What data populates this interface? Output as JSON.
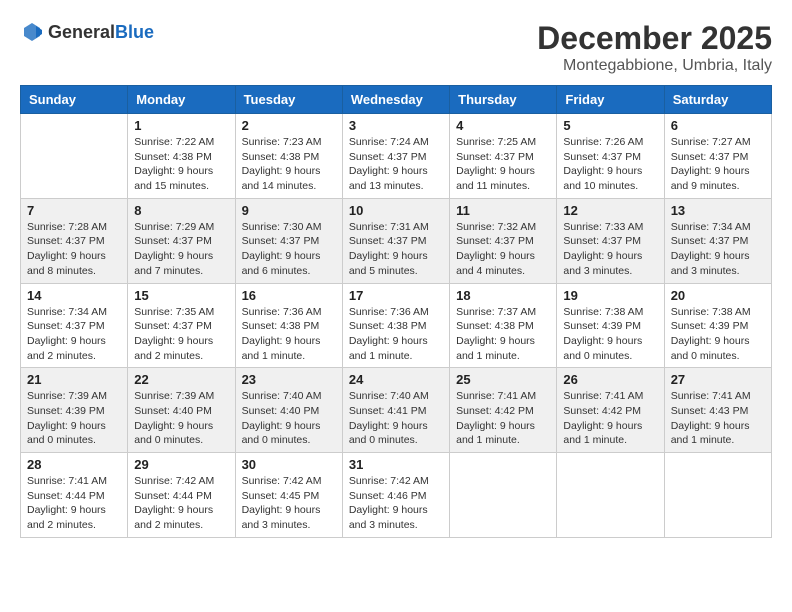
{
  "header": {
    "logo_general": "General",
    "logo_blue": "Blue",
    "month": "December 2025",
    "location": "Montegabbione, Umbria, Italy"
  },
  "weekdays": [
    "Sunday",
    "Monday",
    "Tuesday",
    "Wednesday",
    "Thursday",
    "Friday",
    "Saturday"
  ],
  "weeks": [
    [
      {
        "day": "",
        "info": ""
      },
      {
        "day": "1",
        "info": "Sunrise: 7:22 AM\nSunset: 4:38 PM\nDaylight: 9 hours\nand 15 minutes."
      },
      {
        "day": "2",
        "info": "Sunrise: 7:23 AM\nSunset: 4:38 PM\nDaylight: 9 hours\nand 14 minutes."
      },
      {
        "day": "3",
        "info": "Sunrise: 7:24 AM\nSunset: 4:37 PM\nDaylight: 9 hours\nand 13 minutes."
      },
      {
        "day": "4",
        "info": "Sunrise: 7:25 AM\nSunset: 4:37 PM\nDaylight: 9 hours\nand 11 minutes."
      },
      {
        "day": "5",
        "info": "Sunrise: 7:26 AM\nSunset: 4:37 PM\nDaylight: 9 hours\nand 10 minutes."
      },
      {
        "day": "6",
        "info": "Sunrise: 7:27 AM\nSunset: 4:37 PM\nDaylight: 9 hours\nand 9 minutes."
      }
    ],
    [
      {
        "day": "7",
        "info": "Sunrise: 7:28 AM\nSunset: 4:37 PM\nDaylight: 9 hours\nand 8 minutes."
      },
      {
        "day": "8",
        "info": "Sunrise: 7:29 AM\nSunset: 4:37 PM\nDaylight: 9 hours\nand 7 minutes."
      },
      {
        "day": "9",
        "info": "Sunrise: 7:30 AM\nSunset: 4:37 PM\nDaylight: 9 hours\nand 6 minutes."
      },
      {
        "day": "10",
        "info": "Sunrise: 7:31 AM\nSunset: 4:37 PM\nDaylight: 9 hours\nand 5 minutes."
      },
      {
        "day": "11",
        "info": "Sunrise: 7:32 AM\nSunset: 4:37 PM\nDaylight: 9 hours\nand 4 minutes."
      },
      {
        "day": "12",
        "info": "Sunrise: 7:33 AM\nSunset: 4:37 PM\nDaylight: 9 hours\nand 3 minutes."
      },
      {
        "day": "13",
        "info": "Sunrise: 7:34 AM\nSunset: 4:37 PM\nDaylight: 9 hours\nand 3 minutes."
      }
    ],
    [
      {
        "day": "14",
        "info": "Sunrise: 7:34 AM\nSunset: 4:37 PM\nDaylight: 9 hours\nand 2 minutes."
      },
      {
        "day": "15",
        "info": "Sunrise: 7:35 AM\nSunset: 4:37 PM\nDaylight: 9 hours\nand 2 minutes."
      },
      {
        "day": "16",
        "info": "Sunrise: 7:36 AM\nSunset: 4:38 PM\nDaylight: 9 hours\nand 1 minute."
      },
      {
        "day": "17",
        "info": "Sunrise: 7:36 AM\nSunset: 4:38 PM\nDaylight: 9 hours\nand 1 minute."
      },
      {
        "day": "18",
        "info": "Sunrise: 7:37 AM\nSunset: 4:38 PM\nDaylight: 9 hours\nand 1 minute."
      },
      {
        "day": "19",
        "info": "Sunrise: 7:38 AM\nSunset: 4:39 PM\nDaylight: 9 hours\nand 0 minutes."
      },
      {
        "day": "20",
        "info": "Sunrise: 7:38 AM\nSunset: 4:39 PM\nDaylight: 9 hours\nand 0 minutes."
      }
    ],
    [
      {
        "day": "21",
        "info": "Sunrise: 7:39 AM\nSunset: 4:39 PM\nDaylight: 9 hours\nand 0 minutes."
      },
      {
        "day": "22",
        "info": "Sunrise: 7:39 AM\nSunset: 4:40 PM\nDaylight: 9 hours\nand 0 minutes."
      },
      {
        "day": "23",
        "info": "Sunrise: 7:40 AM\nSunset: 4:40 PM\nDaylight: 9 hours\nand 0 minutes."
      },
      {
        "day": "24",
        "info": "Sunrise: 7:40 AM\nSunset: 4:41 PM\nDaylight: 9 hours\nand 0 minutes."
      },
      {
        "day": "25",
        "info": "Sunrise: 7:41 AM\nSunset: 4:42 PM\nDaylight: 9 hours\nand 1 minute."
      },
      {
        "day": "26",
        "info": "Sunrise: 7:41 AM\nSunset: 4:42 PM\nDaylight: 9 hours\nand 1 minute."
      },
      {
        "day": "27",
        "info": "Sunrise: 7:41 AM\nSunset: 4:43 PM\nDaylight: 9 hours\nand 1 minute."
      }
    ],
    [
      {
        "day": "28",
        "info": "Sunrise: 7:41 AM\nSunset: 4:44 PM\nDaylight: 9 hours\nand 2 minutes."
      },
      {
        "day": "29",
        "info": "Sunrise: 7:42 AM\nSunset: 4:44 PM\nDaylight: 9 hours\nand 2 minutes."
      },
      {
        "day": "30",
        "info": "Sunrise: 7:42 AM\nSunset: 4:45 PM\nDaylight: 9 hours\nand 3 minutes."
      },
      {
        "day": "31",
        "info": "Sunrise: 7:42 AM\nSunset: 4:46 PM\nDaylight: 9 hours\nand 3 minutes."
      },
      {
        "day": "",
        "info": ""
      },
      {
        "day": "",
        "info": ""
      },
      {
        "day": "",
        "info": ""
      }
    ]
  ]
}
